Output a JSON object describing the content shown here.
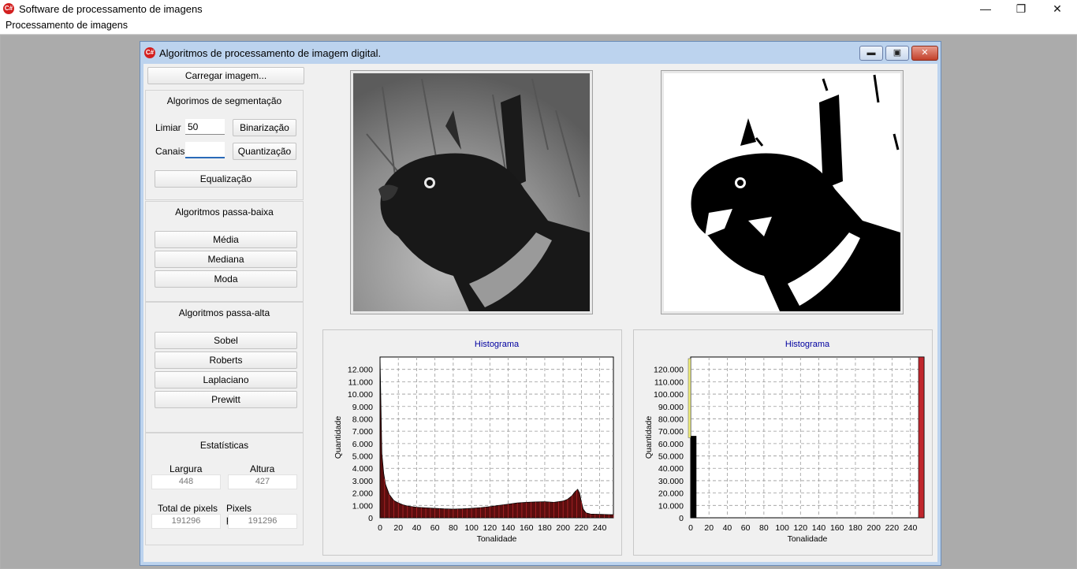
{
  "app": {
    "title": "Software de processamento de imagens",
    "icon_text": "C#",
    "minimize_glyph": "—",
    "maximize_glyph": "❐",
    "close_glyph": "✕"
  },
  "menu": {
    "items": [
      "Processamento de imagens"
    ]
  },
  "child_window": {
    "title": "Algoritmos de processamento de imagem digital.",
    "minimize_glyph": "▬",
    "maximize_glyph": "▣",
    "close_glyph": "✕"
  },
  "controls": {
    "load_button": "Carregar imagem...",
    "segmentation": {
      "title": "Algorimos de segmentação",
      "threshold_label": "Limiar",
      "threshold_value": "50",
      "binarize_button": "Binarização",
      "channels_label": "Canais",
      "channels_value": "",
      "quantize_button": "Quantização",
      "equalize_button": "Equalização"
    },
    "lowpass": {
      "title": "Algoritmos passa-baixa",
      "buttons": [
        "Média",
        "Mediana",
        "Moda"
      ]
    },
    "highpass": {
      "title": "Algoritmos passa-alta",
      "buttons": [
        "Sobel",
        "Roberts",
        "Laplaciano",
        "Prewitt"
      ]
    },
    "stats": {
      "title": "Estatísticas",
      "width_label": "Largura",
      "width_value": "448",
      "height_label": "Altura",
      "height_value": "427",
      "total_label": "Total de pixels",
      "total_value": "191296",
      "processed_label": "Pixels processados",
      "processed_value": "191296"
    }
  },
  "colors": {
    "bar_dark": "#5a0e0e",
    "bar_red": "#c0272d",
    "bar_yellow": "#f2f07a",
    "plot_grid": "#9a9a9a",
    "title_blue": "#0000a0"
  },
  "chart_data": [
    {
      "type": "area",
      "title": "Histograma",
      "xlabel": "Tonalidade",
      "ylabel": "Quantidade",
      "xlim": [
        0,
        255
      ],
      "ylim": [
        0,
        13000
      ],
      "xticks": [
        0,
        20,
        40,
        60,
        80,
        100,
        120,
        140,
        160,
        180,
        200,
        220,
        240
      ],
      "yticks": [
        "0",
        "1.000",
        "2.000",
        "3.000",
        "4.000",
        "5.000",
        "6.000",
        "7.000",
        "8.000",
        "9.000",
        "10.000",
        "11.000",
        "12.000"
      ],
      "grid": true,
      "x": [
        0,
        2,
        4,
        6,
        8,
        10,
        12,
        15,
        20,
        25,
        30,
        40,
        50,
        60,
        70,
        80,
        90,
        100,
        110,
        120,
        130,
        140,
        150,
        160,
        170,
        180,
        190,
        200,
        205,
        210,
        213,
        216,
        218,
        220,
        222,
        225,
        230,
        240,
        250,
        255
      ],
      "values": [
        13000,
        5200,
        3600,
        2700,
        2300,
        1900,
        1700,
        1400,
        1200,
        1050,
        950,
        850,
        800,
        760,
        720,
        700,
        720,
        760,
        820,
        900,
        1000,
        1100,
        1200,
        1250,
        1280,
        1300,
        1250,
        1350,
        1500,
        1800,
        2100,
        2300,
        2000,
        1300,
        700,
        400,
        300,
        280,
        250,
        250
      ]
    },
    {
      "type": "bar",
      "title": "Histograma",
      "xlabel": "Tonalidade",
      "ylabel": "Quantidade",
      "xlim": [
        0,
        255
      ],
      "ylim": [
        0,
        130000
      ],
      "xticks": [
        0,
        20,
        40,
        60,
        80,
        100,
        120,
        140,
        160,
        180,
        200,
        220,
        240
      ],
      "yticks": [
        "0",
        "10.000",
        "20.000",
        "30.000",
        "40.000",
        "50.000",
        "60.000",
        "70.000",
        "80.000",
        "90.000",
        "100.000",
        "110.000",
        "120.000"
      ],
      "grid": true,
      "x": [
        0,
        255
      ],
      "values": [
        66000,
        130000
      ]
    }
  ]
}
